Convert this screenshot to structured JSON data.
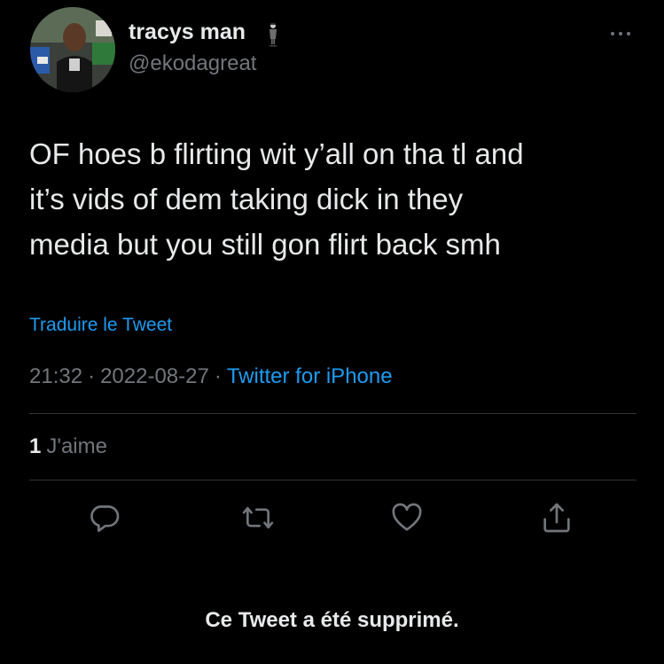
{
  "author": {
    "display_name": "tracys man",
    "name_emoji": "man-in-suit-levitating-icon",
    "handle": "@ekodagreat"
  },
  "tweet": {
    "lines": [
      "OF hoes b flirting wit y’all on tha tl and",
      "it’s vids of dem taking dick in they",
      "media but you still gon flirt back smh"
    ],
    "translate_label": "Traduire le Tweet",
    "time": "21:32",
    "date": "2022-08-27",
    "separator": "·",
    "source": "Twitter for iPhone",
    "like_count": "1",
    "like_label": "J'aime"
  },
  "actions": [
    {
      "icon": "reply-icon"
    },
    {
      "icon": "retweet-icon"
    },
    {
      "icon": "like-icon"
    },
    {
      "icon": "share-icon"
    }
  ],
  "notice": {
    "deleted": "Ce Tweet a été supprimé."
  },
  "colors": {
    "background": "#000000",
    "text": "#e7e9ea",
    "secondary": "#71767b",
    "accent": "#1d9bf0",
    "divider": "#2f3336"
  }
}
